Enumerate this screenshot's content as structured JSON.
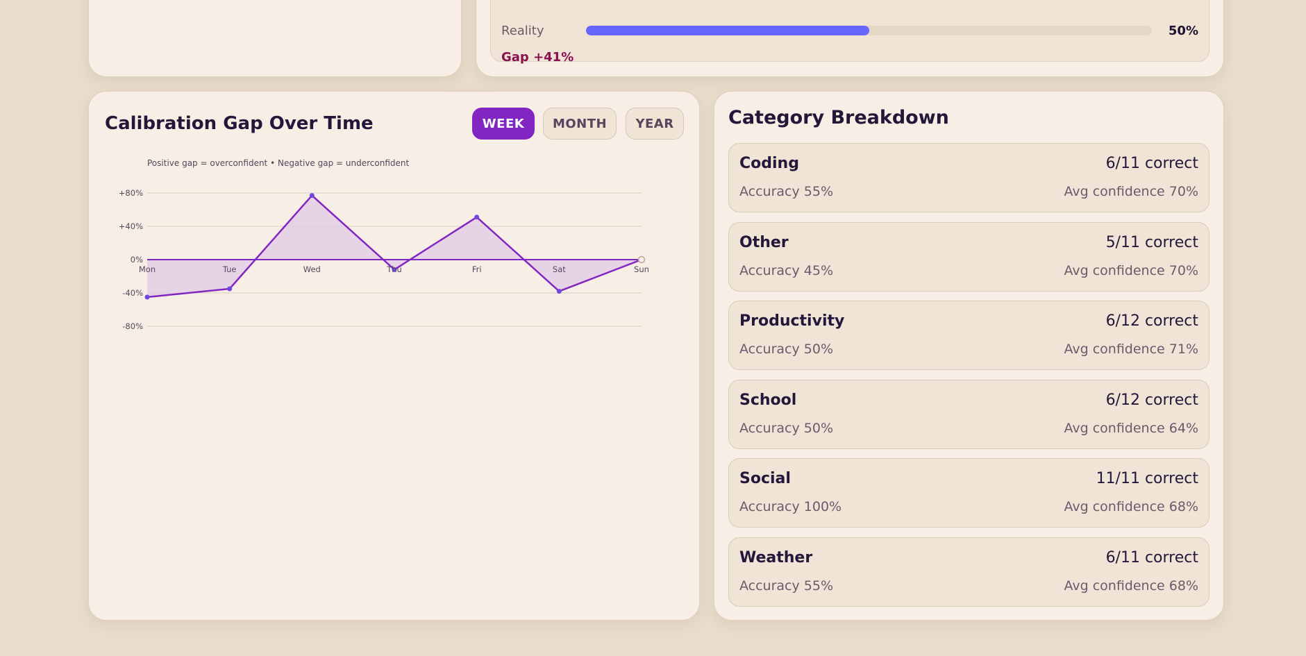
{
  "reality": {
    "label": "Reality",
    "value_text": "50%",
    "progress": 0.5,
    "gap_text": "Gap +41%",
    "bar_color": "#6666ff"
  },
  "chart_card": {
    "title": "Calibration Gap Over Time",
    "tabs": [
      {
        "label": "WEEK",
        "active": true
      },
      {
        "label": "MONTH",
        "active": false
      },
      {
        "label": "YEAR",
        "active": false
      }
    ]
  },
  "chart_data": {
    "type": "area",
    "subtitle": "Positive gap = overconfident • Negative gap = underconfident",
    "x": [
      "Mon",
      "Tue",
      "Wed",
      "Thu",
      "Fri",
      "Sat",
      "Sun"
    ],
    "series": [
      {
        "values": [
          -45,
          -35,
          77,
          -12,
          51,
          -38,
          0
        ],
        "color": "#8226c2"
      }
    ],
    "ylim": [
      -80,
      80
    ],
    "yticks": [
      80,
      40,
      0,
      -40,
      -80
    ],
    "ytick_labels": [
      "+80%",
      "+40%",
      "0%",
      "-40%",
      "-80%"
    ],
    "grid": true,
    "colors": {
      "line": "#8226c2",
      "fill": "#e2c9e6",
      "point": "#7048e0"
    }
  },
  "categories_card": {
    "title": "Category Breakdown",
    "items": [
      {
        "name": "Coding",
        "correct": "6/11 correct",
        "accuracy": "Accuracy 55%",
        "confidence": "Avg confidence 70%"
      },
      {
        "name": "Other",
        "correct": "5/11 correct",
        "accuracy": "Accuracy 45%",
        "confidence": "Avg confidence 70%"
      },
      {
        "name": "Productivity",
        "correct": "6/12 correct",
        "accuracy": "Accuracy 50%",
        "confidence": "Avg confidence 71%"
      },
      {
        "name": "School",
        "correct": "6/12 correct",
        "accuracy": "Accuracy 50%",
        "confidence": "Avg confidence 64%"
      },
      {
        "name": "Social",
        "correct": "11/11 correct",
        "accuracy": "Accuracy 100%",
        "confidence": "Avg confidence 68%"
      },
      {
        "name": "Weather",
        "correct": "6/11 correct",
        "accuracy": "Accuracy 55%",
        "confidence": "Avg confidence 68%"
      }
    ]
  }
}
